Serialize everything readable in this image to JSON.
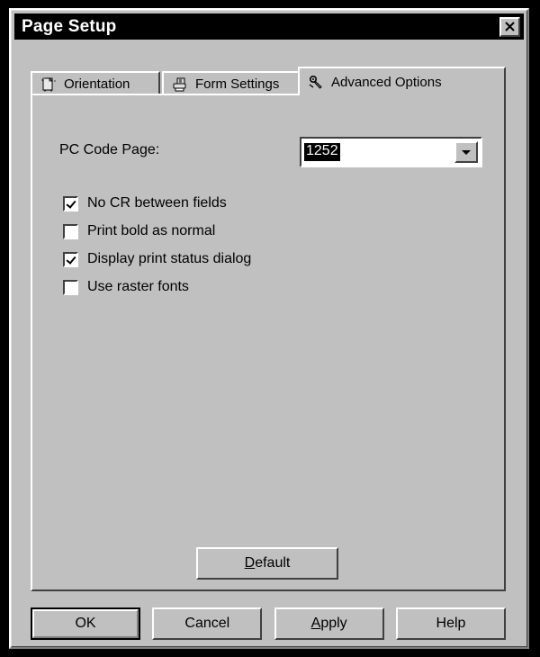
{
  "window": {
    "title": "Page Setup",
    "close_label": "✕",
    "close_icon": "close-x-icon"
  },
  "tabs": [
    {
      "label": "Orientation",
      "icon": "page-orientation-icon",
      "active": false
    },
    {
      "label": "Form Settings",
      "icon": "printer-icon",
      "active": false
    },
    {
      "label": "Advanced Options",
      "icon": "tools-gear-icon",
      "active": true
    }
  ],
  "form": {
    "code_page": {
      "label": "PC Code Page:",
      "value": "1252",
      "dropdown_icon": "chevron-down-icon"
    },
    "checkboxes": [
      {
        "label": "No CR between fields",
        "checked": true
      },
      {
        "label": "Print bold as normal",
        "checked": false
      },
      {
        "label": "Display print status dialog",
        "checked": true
      },
      {
        "label": "Use raster fonts",
        "checked": false
      }
    ]
  },
  "actions": {
    "default": {
      "label": "Default",
      "accel": "D"
    },
    "ok": {
      "label": "OK",
      "accel": ""
    },
    "cancel": {
      "label": "Cancel",
      "accel": ""
    },
    "apply": {
      "label": "Apply",
      "accel": "A"
    },
    "help": {
      "label": "Help",
      "accel": ""
    }
  },
  "colors": {
    "face": "#c0c0c0",
    "titlebar": "#000000",
    "titlebar_text": "#ffffff",
    "highlight": "#000000",
    "highlight_text": "#ffffff",
    "field": "#ffffff",
    "shadow": "#404040",
    "light": "#ffffff",
    "backdrop": "#000000"
  }
}
